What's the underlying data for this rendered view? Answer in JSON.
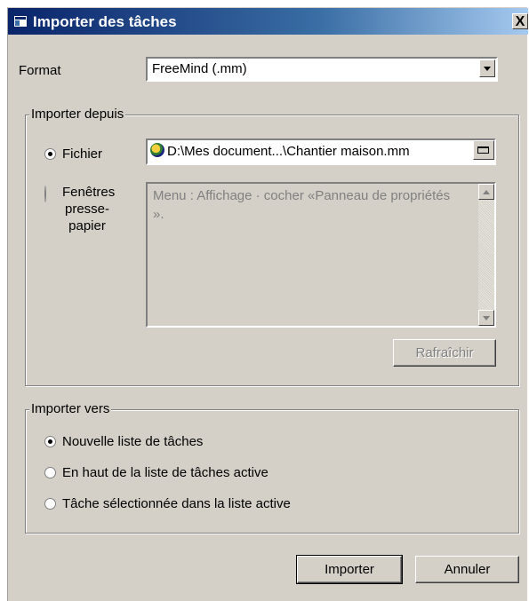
{
  "window": {
    "title": "Importer des tâches",
    "close_label": "X"
  },
  "format": {
    "label": "Format",
    "selected": "FreeMind (.mm)"
  },
  "import_from": {
    "group_label": "Importer depuis",
    "file_option_label": "Fichier",
    "file_path": "D:\\Mes document...\\Chantier maison.mm",
    "clipboard_option_label_lines": [
      "Fenêtres",
      "presse-",
      "papier"
    ],
    "clipboard_hint": "Menu : Affichage · cocher «Panneau de propriétés ».",
    "refresh_label": "Rafraîchir"
  },
  "import_to": {
    "group_label": "Importer vers",
    "options": [
      {
        "label": "Nouvelle liste de tâches",
        "checked": true
      },
      {
        "label": "En haut de la liste de tâches active",
        "checked": false
      },
      {
        "label": "Tâche sélectionnée dans la liste active",
        "checked": false
      }
    ]
  },
  "buttons": {
    "import_label": "Importer",
    "cancel_label": "Annuler"
  },
  "icons": [
    "app-icon",
    "close-icon",
    "dropdown-arrow-icon",
    "freemind-file-icon",
    "open-folder-icon",
    "scroll-up-icon",
    "scroll-down-icon"
  ],
  "colors": {
    "titlebar_start": "#0a246a",
    "titlebar_end": "#a6caf0",
    "face": "#d4d0c8"
  }
}
